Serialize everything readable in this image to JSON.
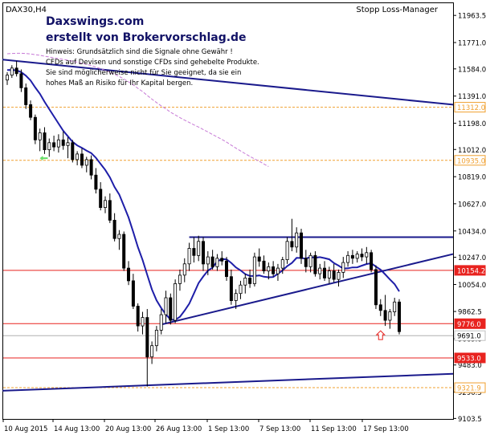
{
  "window": {
    "symbol_label": "DAX30,H4",
    "expert_label": "Stopp Loss-Manager"
  },
  "overlay": {
    "site": "Daxswings.com",
    "credit": "erstellt von Brokervorschlag.de",
    "disclaimer": [
      "Hinweis: Grundsätzlich sind die Signale ohne Gewähr !",
      "CFDs auf Devisen und sonstige CFDs sind gehebelte Produkte.",
      "Sie sind möglicherweise nicht für Sie geeignet, da sie ein",
      "hohes Maß an Risiko für Ihr Kapital bergen."
    ]
  },
  "colors": {
    "background": "#ffffff",
    "candle_up": "#ffffff",
    "candle_down": "#000000",
    "candle_outline": "#000000",
    "moving_average": "#1e1ea8",
    "long_moving_average": "#c77ad6",
    "trendline": "#1a1a8c",
    "support_resistance": "#e8231f",
    "fib_level": "#f0a030",
    "bid_line": "#b0b0b0",
    "arrow": "#e8231f",
    "marker": "#66dd66"
  },
  "chart_data": {
    "type": "candlestick",
    "instrument": "DAX30",
    "timeframe": "H4",
    "y_axis": {
      "min": 9100,
      "max": 12050,
      "ticks": [
        "11963.5",
        "11771.0",
        "11584.0",
        "11391.0",
        "11198.0",
        "11012.0",
        "10819.0",
        "10627.0",
        "10434.0",
        "10247.0",
        "10054.0",
        "9862.5",
        "9669.0",
        "9483.0",
        "9290.5",
        "9103.5"
      ]
    },
    "x_axis": {
      "labels": [
        "10 Aug 2015",
        "14 Aug 13:00",
        "20 Aug 13:00",
        "26 Aug 13:00",
        "1 Sep 13:00",
        "7 Sep 13:00",
        "11 Sep 13:00",
        "17 Sep 13:00"
      ]
    },
    "horizontal_levels": [
      {
        "label": "11312.0",
        "value": 11312.0,
        "style": "fib"
      },
      {
        "label": "10935.0",
        "value": 10935.0,
        "style": "fib"
      },
      {
        "label": "10154.2",
        "value": 10154.2,
        "style": "sr"
      },
      {
        "label": "9776.0",
        "value": 9776.0,
        "style": "sr"
      },
      {
        "label": "9533.0",
        "value": 9533.0,
        "style": "sr"
      },
      {
        "label": "9321.9",
        "value": 9321.9,
        "style": "fib"
      }
    ],
    "current_price": {
      "label": "9691.0",
      "value": 9691.0
    },
    "trendlines": [
      {
        "name": "long-term-resistance",
        "start": {
          "bar": -1,
          "price": 11650
        },
        "end": {
          "bar": 100,
          "price": 11330
        }
      },
      {
        "name": "range-top",
        "start": {
          "bar": 39,
          "price": 10390
        },
        "end": {
          "bar": 100,
          "price": 10390
        }
      },
      {
        "name": "rising-support",
        "start": {
          "bar": 33,
          "price": 9770
        },
        "end": {
          "bar": 100,
          "price": 10270
        }
      },
      {
        "name": "long-term-support",
        "start": {
          "bar": -1,
          "price": 9300
        },
        "end": {
          "bar": 100,
          "price": 9420
        }
      }
    ],
    "candles": [
      [
        11505,
        11560,
        11470,
        11540
      ],
      [
        11540,
        11610,
        11520,
        11590
      ],
      [
        11590,
        11640,
        11530,
        11550
      ],
      [
        11550,
        11580,
        11420,
        11450
      ],
      [
        11450,
        11480,
        11300,
        11330
      ],
      [
        11330,
        11360,
        11220,
        11240
      ],
      [
        11240,
        11260,
        11050,
        11080
      ],
      [
        11080,
        11160,
        11000,
        11130
      ],
      [
        11130,
        11170,
        10980,
        11010
      ],
      [
        11010,
        11090,
        10960,
        11060
      ],
      [
        11060,
        11110,
        11000,
        11030
      ],
      [
        11030,
        11120,
        10990,
        11080
      ],
      [
        11080,
        11140,
        11010,
        11040
      ],
      [
        11040,
        11100,
        10950,
        11060
      ],
      [
        11060,
        11080,
        10920,
        10940
      ],
      [
        10940,
        11000,
        10900,
        10980
      ],
      [
        10980,
        11020,
        10880,
        10900
      ],
      [
        10900,
        10960,
        10850,
        10940
      ],
      [
        10940,
        10970,
        10800,
        10830
      ],
      [
        10830,
        10880,
        10700,
        10730
      ],
      [
        10730,
        10780,
        10580,
        10600
      ],
      [
        10600,
        10680,
        10560,
        10650
      ],
      [
        10650,
        10700,
        10490,
        10510
      ],
      [
        10510,
        10560,
        10360,
        10380
      ],
      [
        10380,
        10440,
        10300,
        10410
      ],
      [
        10410,
        10430,
        10150,
        10170
      ],
      [
        10170,
        10220,
        10050,
        10080
      ],
      [
        10080,
        10130,
        9880,
        9900
      ],
      [
        9900,
        9920,
        9720,
        9760
      ],
      [
        9760,
        9860,
        9700,
        9820
      ],
      [
        9820,
        9880,
        9330,
        9540
      ],
      [
        9540,
        9650,
        9490,
        9620
      ],
      [
        9620,
        9760,
        9580,
        9730
      ],
      [
        9730,
        9880,
        9700,
        9840
      ],
      [
        9840,
        10010,
        9780,
        9960
      ],
      [
        9960,
        9990,
        9770,
        9800
      ],
      [
        9800,
        10090,
        9780,
        10060
      ],
      [
        10060,
        10160,
        10010,
        10120
      ],
      [
        10120,
        10240,
        10070,
        10200
      ],
      [
        10200,
        10350,
        10150,
        10310
      ],
      [
        10310,
        10390,
        10210,
        10260
      ],
      [
        10260,
        10400,
        10220,
        10360
      ],
      [
        10360,
        10390,
        10150,
        10200
      ],
      [
        10200,
        10290,
        10120,
        10250
      ],
      [
        10250,
        10300,
        10160,
        10180
      ],
      [
        10180,
        10270,
        10150,
        10240
      ],
      [
        10240,
        10290,
        10190,
        10220
      ],
      [
        10220,
        10250,
        10080,
        10110
      ],
      [
        10110,
        10160,
        9910,
        9940
      ],
      [
        9940,
        10020,
        9880,
        9990
      ],
      [
        9990,
        10080,
        9950,
        10050
      ],
      [
        10050,
        10130,
        9990,
        10100
      ],
      [
        10100,
        10160,
        10030,
        10060
      ],
      [
        10060,
        10280,
        10040,
        10250
      ],
      [
        10250,
        10310,
        10180,
        10220
      ],
      [
        10220,
        10260,
        10130,
        10150
      ],
      [
        10150,
        10210,
        10090,
        10180
      ],
      [
        10180,
        10220,
        10110,
        10130
      ],
      [
        10130,
        10200,
        10080,
        10170
      ],
      [
        10170,
        10250,
        10130,
        10230
      ],
      [
        10230,
        10390,
        10200,
        10360
      ],
      [
        10360,
        10520,
        10290,
        10320
      ],
      [
        10320,
        10460,
        10280,
        10420
      ],
      [
        10420,
        10450,
        10200,
        10240
      ],
      [
        10240,
        10300,
        10140,
        10180
      ],
      [
        10180,
        10280,
        10140,
        10260
      ],
      [
        10260,
        10290,
        10110,
        10130
      ],
      [
        10130,
        10200,
        10090,
        10170
      ],
      [
        10170,
        10220,
        10080,
        10100
      ],
      [
        10100,
        10180,
        10060,
        10150
      ],
      [
        10150,
        10200,
        10070,
        10090
      ],
      [
        10090,
        10160,
        10040,
        10140
      ],
      [
        10140,
        10250,
        10100,
        10210
      ],
      [
        10210,
        10290,
        10180,
        10260
      ],
      [
        10260,
        10300,
        10200,
        10240
      ],
      [
        10240,
        10290,
        10210,
        10270
      ],
      [
        10270,
        10310,
        10220,
        10250
      ],
      [
        10250,
        10320,
        10200,
        10280
      ],
      [
        10280,
        10300,
        10140,
        10160
      ],
      [
        10160,
        10190,
        9880,
        9910
      ],
      [
        9910,
        9950,
        9830,
        9870
      ],
      [
        9870,
        9980,
        9760,
        9800
      ],
      [
        9800,
        9880,
        9740,
        9860
      ],
      [
        9860,
        9960,
        9830,
        9930
      ],
      [
        9930,
        9950,
        9700,
        9720
      ]
    ]
  }
}
